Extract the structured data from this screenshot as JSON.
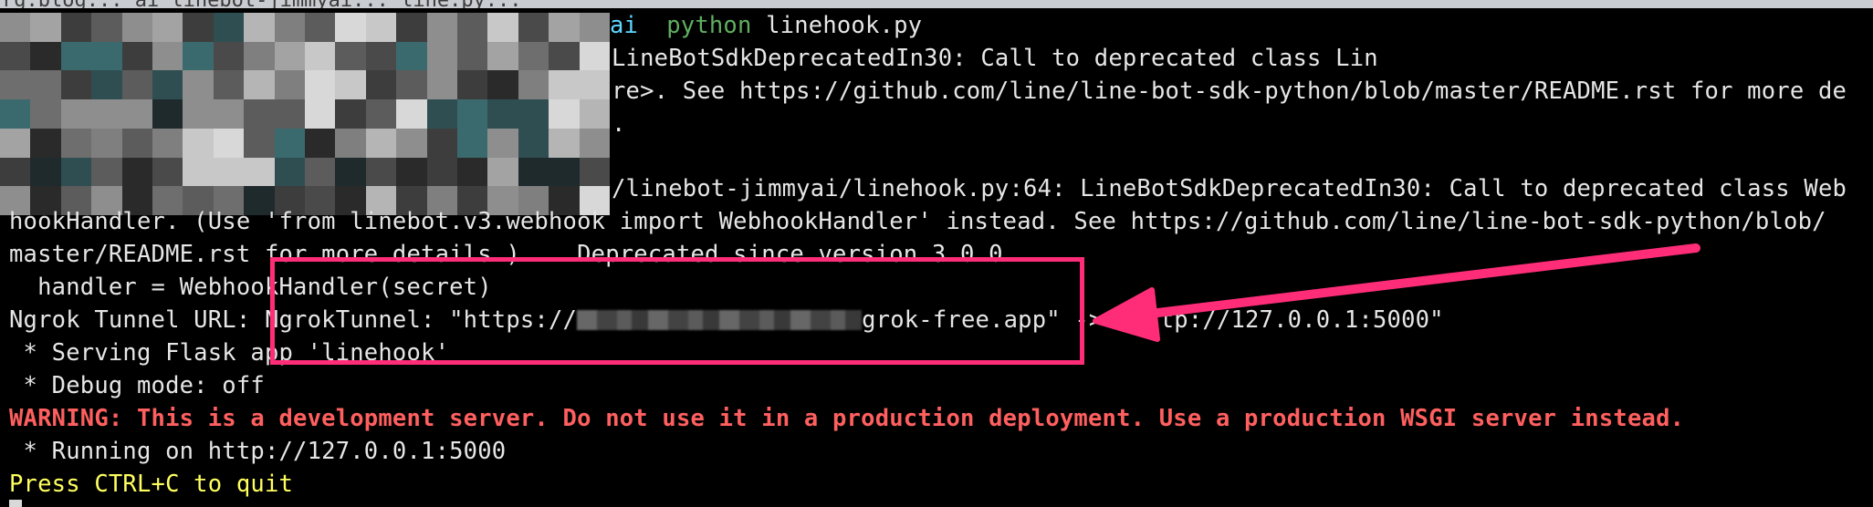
{
  "topbar": {
    "text": "rg.blog... ai linebot-jimmyai... line.py...  "
  },
  "prompt": {
    "venv": "ai",
    "command": "python",
    "args": "linehook.py"
  },
  "output": {
    "line1": "LineBotSdkDeprecatedIn30: Call to deprecated class Lin",
    "line2": "re>. See https://github.com/line/line-bot-sdk-python/blob/master/README.rst for more de",
    "line3": ".",
    "line5": "/linebot-jimmyai/linehook.py:64: LineBotSdkDeprecatedIn30: Call to deprecated class Web",
    "line6": "hookHandler. (Use 'from linebot.v3.webhook import WebhookHandler' instead. See https://github.com/line/line-bot-sdk-python/blob/",
    "line7": "master/README.rst for more details.)    Deprecated since version 3.0.0.",
    "line8": "  handler = WebhookHandler(secret)",
    "line9_prefix": "Ngrok Tunnel URL: NgrokTunnel: \"https://",
    "line9_suffix": "grok-free.app\" -> \"http://127.0.0.1:5000\"",
    "line10": " * Serving Flask app 'linehook'",
    "line11": " * Debug mode: off",
    "line12": "WARNING: This is a development server. Do not use it in a production deployment. Use a production WSGI server instead.",
    "line13": " * Running on http://127.0.0.1:5000",
    "line14": "Press CTRL+C to quit"
  },
  "colors": {
    "background": "#000000",
    "text": "#e6e6e6",
    "warning": "#ff5f5f",
    "quit_hint": "#ffff5f",
    "annotation": "#ff2d78"
  }
}
